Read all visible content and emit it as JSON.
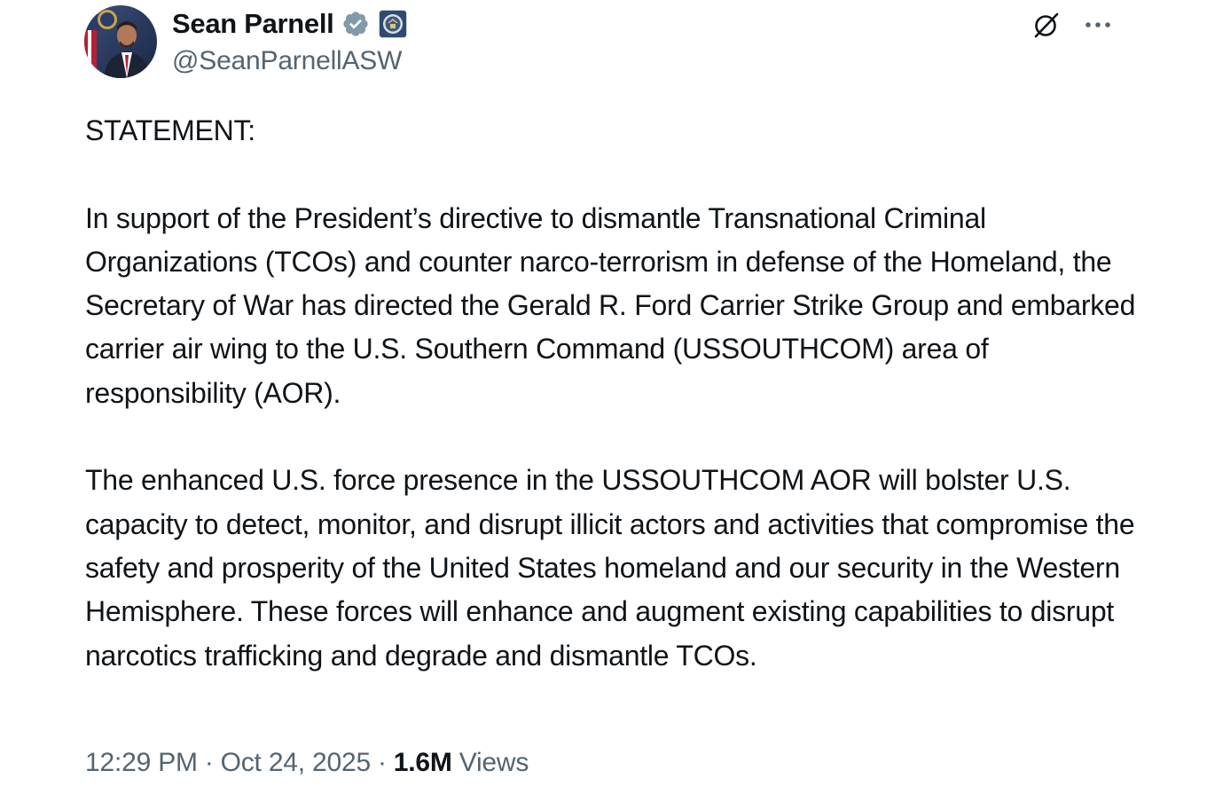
{
  "author": {
    "display_name": "Sean Parnell",
    "handle": "@SeanParnellASW",
    "verified_icon": "verified-badge-icon",
    "affiliate_icon": "department-seal-icon"
  },
  "actions": {
    "grok_icon": "grok-icon",
    "more_icon": "more-options-icon"
  },
  "tweet": {
    "heading": "STATEMENT:",
    "paragraph_1": "In support of the President’s directive to dismantle Transnational Criminal Organizations (TCOs) and counter narco-terrorism in defense of the Homeland, the Secretary of War has directed the Gerald R. Ford Carrier Strike Group and embarked carrier air wing to the U.S. Southern Command (USSOUTHCOM) area of responsibility (AOR).",
    "paragraph_2": "The enhanced U.S. force presence in the USSOUTHCOM AOR will bolster U.S. capacity to detect, monitor, and disrupt illicit actors and activities that compromise the safety and prosperity of the United States homeland and our security in the Western Hemisphere. These forces will enhance and augment existing capabilities to disrupt narcotics trafficking and degrade and dismantle TCOs."
  },
  "meta": {
    "time": "12:29 PM",
    "separator": "·",
    "date": "Oct 24, 2025",
    "views_count": "1.6M",
    "views_label": "Views"
  },
  "colors": {
    "text": "#0f1419",
    "secondary": "#536471",
    "verified": "#829aab"
  }
}
